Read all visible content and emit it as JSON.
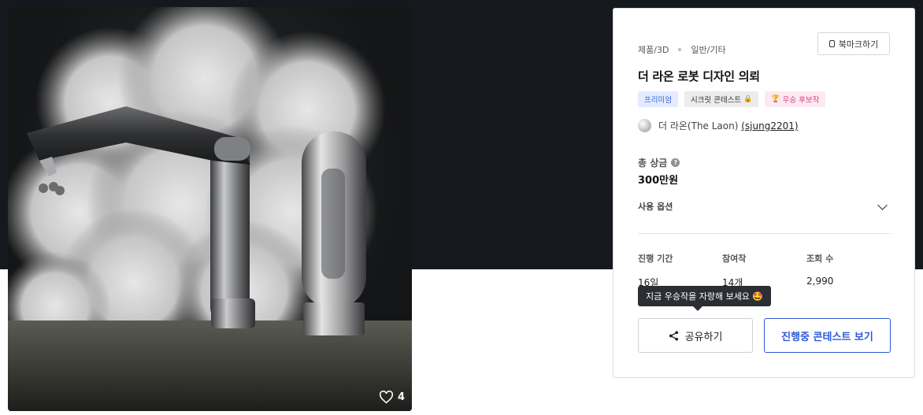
{
  "hero": {
    "likes_count": "4",
    "heart_icon": "heart-outline-icon"
  },
  "breadcrumb": {
    "category": "제품/3D",
    "subcategory": "일반/기타"
  },
  "bookmark": {
    "label": "북마크하기",
    "icon": "bookmark-icon"
  },
  "contest": {
    "title": "더 라온 로봇 디자인 의뢰",
    "badges": [
      {
        "label": "프리미엄",
        "icon": ""
      },
      {
        "label": "시크릿 콘테스트",
        "icon": "🔒"
      },
      {
        "label": "우승 후보작",
        "icon": "🏆"
      }
    ],
    "author": {
      "name": "더 라온(The Laon)",
      "handle": "(sjung2201)"
    }
  },
  "prize": {
    "label": "총 상금",
    "help_icon": "?",
    "value": "300만원"
  },
  "usage_options": {
    "label": "사용 옵션",
    "icon": "chevron-down-icon"
  },
  "stats": [
    {
      "label": "진행 기간",
      "value": "16일"
    },
    {
      "label": "참여작",
      "value": "14개"
    },
    {
      "label": "조회 수",
      "value": "2,990"
    }
  ],
  "tooltip": {
    "text": "지금 우승작을 자랑해 보세요",
    "emoji": "🤩"
  },
  "buttons": {
    "share": "공유하기",
    "view_ongoing": "진행중 콘테스트 보기"
  },
  "colors": {
    "top_band": "#15191e",
    "accent": "#2e5ad6",
    "premium_bg": "#e3ecff",
    "winner_bg": "#fde9f2"
  }
}
